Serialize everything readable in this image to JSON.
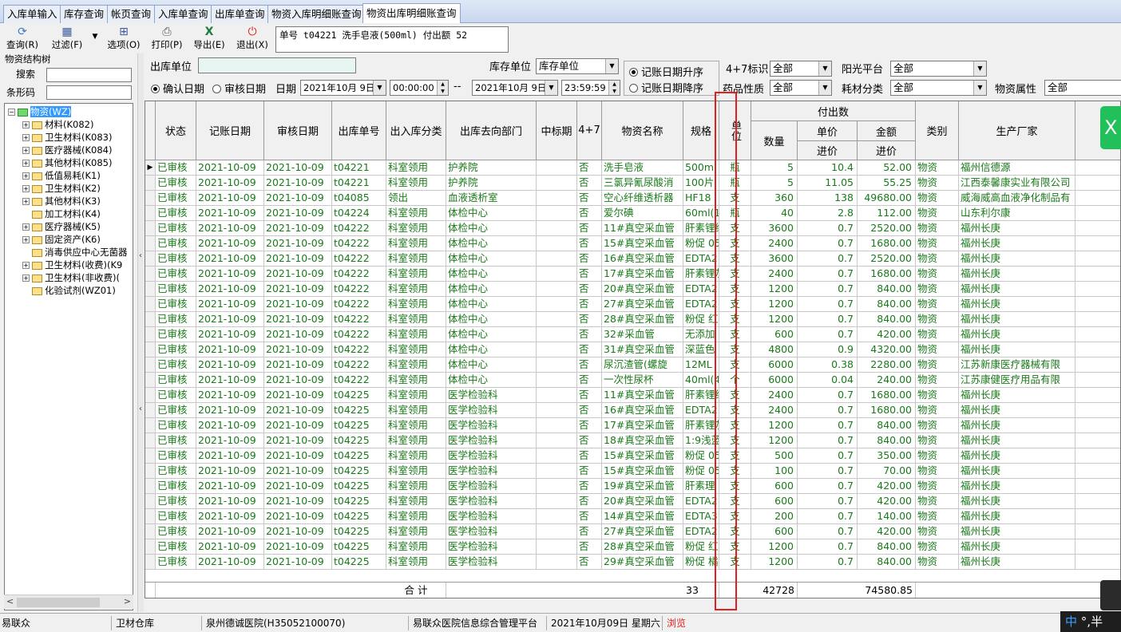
{
  "tabs": [
    "入库单输入",
    "库存查询",
    "帐页查询",
    "入库单查询",
    "出库单查询",
    "物资入库明细账查询",
    "物资出库明细账查询"
  ],
  "toolbar": {
    "query": "查询(R)",
    "filter": "过滤(F)",
    "options": "选项(O)",
    "print": "打印(P)",
    "export": "导出(E)",
    "exit": "退出(X)"
  },
  "info_text": "单号 t04221  洗手皂液(500ml) 付出额 52",
  "left": {
    "title": "物资结构树",
    "search_label": "搜索",
    "barcode_label": "条形码",
    "tree": [
      {
        "label": "物资(WZ)",
        "level": 0,
        "exp": "−",
        "selected": true
      },
      {
        "label": "材料(K082)",
        "level": 1,
        "exp": "+"
      },
      {
        "label": "卫生材料(K083)",
        "level": 1,
        "exp": "+"
      },
      {
        "label": "医疗器械(K084)",
        "level": 1,
        "exp": "+"
      },
      {
        "label": "其他材料(K085)",
        "level": 1,
        "exp": "+"
      },
      {
        "label": "低值易耗(K1)",
        "level": 1,
        "exp": "+"
      },
      {
        "label": "卫生材料(K2)",
        "level": 1,
        "exp": "+"
      },
      {
        "label": "其他材料(K3)",
        "level": 1,
        "exp": "+"
      },
      {
        "label": "加工材料(K4)",
        "level": 1,
        "exp": ""
      },
      {
        "label": "医疗器械(K5)",
        "level": 1,
        "exp": "+"
      },
      {
        "label": "固定资产(K6)",
        "level": 1,
        "exp": "+"
      },
      {
        "label": "消毒供应中心无菌器",
        "level": 1,
        "exp": ""
      },
      {
        "label": "卫生材料(收费)(K9",
        "level": 1,
        "exp": "+"
      },
      {
        "label": "卫生材料(非收费)(",
        "level": 1,
        "exp": "+"
      },
      {
        "label": "化验试剂(WZ01)",
        "level": 1,
        "exp": ""
      }
    ]
  },
  "filters": {
    "out_unit_label": "出库单位",
    "stock_unit_label": "库存单位",
    "stock_unit_value": "库存单位",
    "sort_asc": "记账日期升序",
    "sort_desc": "记账日期降序",
    "flag47_label": "4+7标识",
    "flag47_value": "全部",
    "sunplatform_label": "阳光平台",
    "sunplatform_value": "全部",
    "drug_label": "药品性质",
    "drug_value": "全部",
    "consum_label": "耗材分类",
    "consum_value": "全部",
    "attr_label": "物资属性",
    "attr_value": "全部",
    "confirm_date": "确认日期",
    "audit_date": "审核日期",
    "date_label": "日期",
    "date_from": "2021年10月 9日",
    "time_from": "00:00:00",
    "dash": "--",
    "date_to": "2021年10月 9日",
    "time_to": "23:59:59"
  },
  "grid": {
    "headers": {
      "status": "状态",
      "book_date": "记账日期",
      "audit_date": "审核日期",
      "out_no": "出库单号",
      "in_out_type": "出入库分类",
      "dept": "出库去向部门",
      "bid": "中标期",
      "plus47": "4+7",
      "name": "物资名称",
      "spec": "规格",
      "unit": "单位",
      "pay": "付出数",
      "qty": "数量",
      "unit_price": "单价",
      "purchase_price1": "进价",
      "amount": "金额",
      "purchase_price2": "进价",
      "category": "类别",
      "maker": "生产厂家"
    },
    "rows": [
      [
        "已审核",
        "2021-10-09",
        "2021-10-09",
        "t04221",
        "科室领用",
        "护养院",
        "",
        "否",
        "洗手皂液",
        "500ml",
        "瓶",
        "5",
        "10.4",
        "52.00",
        "物资",
        "福州信德源"
      ],
      [
        "已审核",
        "2021-10-09",
        "2021-10-09",
        "t04221",
        "科室领用",
        "护养院",
        "",
        "否",
        "三氯异氰尿酸消",
        "100片",
        "瓶",
        "5",
        "11.05",
        "55.25",
        "物资",
        "江西泰馨康实业有限公司"
      ],
      [
        "已审核",
        "2021-10-09",
        "2021-10-09",
        "t04085",
        "领出",
        "血液透析室",
        "",
        "否",
        "空心纤维透析器",
        "HF18",
        "支",
        "360",
        "138",
        "49680.00",
        "物资",
        "威海威高血液净化制品有"
      ],
      [
        "已审核",
        "2021-10-09",
        "2021-10-09",
        "t04224",
        "科室领用",
        "体检中心",
        "",
        "否",
        "爱尔碘",
        "60ml(10ml",
        "瓶",
        "40",
        "2.8",
        "112.00",
        "物资",
        "山东利尔康"
      ],
      [
        "已审核",
        "2021-10-09",
        "2021-10-09",
        "t04222",
        "科室领用",
        "体检中心",
        "",
        "否",
        "11#真空采血管",
        "肝素锂绿",
        "支",
        "3600",
        "0.7",
        "2520.00",
        "物资",
        "福州长庚"
      ],
      [
        "已审核",
        "2021-10-09",
        "2021-10-09",
        "t04222",
        "科室领用",
        "体检中心",
        "",
        "否",
        "15#真空采血管",
        "粉促 05ml",
        "支",
        "2400",
        "0.7",
        "1680.00",
        "物资",
        "福州长庚"
      ],
      [
        "已审核",
        "2021-10-09",
        "2021-10-09",
        "t04222",
        "科室领用",
        "体检中心",
        "",
        "否",
        "16#真空采血管",
        "EDTA2K (",
        "支",
        "3600",
        "0.7",
        "2520.00",
        "物资",
        "福州长庚"
      ],
      [
        "已审核",
        "2021-10-09",
        "2021-10-09",
        "t04222",
        "科室领用",
        "体检中心",
        "",
        "否",
        "17#真空采血管",
        "肝素锂灰",
        "支",
        "2400",
        "0.7",
        "1680.00",
        "物资",
        "福州长庚"
      ],
      [
        "已审核",
        "2021-10-09",
        "2021-10-09",
        "t04222",
        "科室领用",
        "体检中心",
        "",
        "否",
        "20#真空采血管",
        "EDTA2K 紫",
        "支",
        "1200",
        "0.7",
        "840.00",
        "物资",
        "福州长庚"
      ],
      [
        "已审核",
        "2021-10-09",
        "2021-10-09",
        "t04222",
        "科室领用",
        "体检中心",
        "",
        "否",
        "27#真空采血管",
        "EDTA2K (",
        "支",
        "1200",
        "0.7",
        "840.00",
        "物资",
        "福州长庚"
      ],
      [
        "已审核",
        "2021-10-09",
        "2021-10-09",
        "t04222",
        "科室领用",
        "体检中心",
        "",
        "否",
        "28#真空采血管",
        "粉促  红",
        "支",
        "1200",
        "0.7",
        "840.00",
        "物资",
        "福州长庚"
      ],
      [
        "已审核",
        "2021-10-09",
        "2021-10-09",
        "t04222",
        "科室领用",
        "体检中心",
        "",
        "否",
        "32#采血管",
        "无添加",
        "支",
        "600",
        "0.7",
        "420.00",
        "物资",
        "福州长庚"
      ],
      [
        "已审核",
        "2021-10-09",
        "2021-10-09",
        "t04222",
        "科室领用",
        "体检中心",
        "",
        "否",
        "31#真空采血管",
        "深蓝色",
        "支",
        "4800",
        "0.9",
        "4320.00",
        "物资",
        "福州长庚"
      ],
      [
        "已审核",
        "2021-10-09",
        "2021-10-09",
        "t04222",
        "科室领用",
        "体检中心",
        "",
        "否",
        "尿沉渣管(螺旋",
        "12ML",
        "支",
        "6000",
        "0.38",
        "2280.00",
        "物资",
        "江苏新康医疗器械有限"
      ],
      [
        "已审核",
        "2021-10-09",
        "2021-10-09",
        "t04222",
        "科室领用",
        "体检中心",
        "",
        "否",
        "一次性尿杯",
        "40ml(40C",
        "个",
        "6000",
        "0.04",
        "240.00",
        "物资",
        "江苏康健医疗用品有限"
      ],
      [
        "已审核",
        "2021-10-09",
        "2021-10-09",
        "t04225",
        "科室领用",
        "医学检验科",
        "",
        "否",
        "11#真空采血管",
        "肝素锂绿",
        "支",
        "2400",
        "0.7",
        "1680.00",
        "物资",
        "福州长庚"
      ],
      [
        "已审核",
        "2021-10-09",
        "2021-10-09",
        "t04225",
        "科室领用",
        "医学检验科",
        "",
        "否",
        "16#真空采血管",
        "EDTA2K (",
        "支",
        "2400",
        "0.7",
        "1680.00",
        "物资",
        "福州长庚"
      ],
      [
        "已审核",
        "2021-10-09",
        "2021-10-09",
        "t04225",
        "科室领用",
        "医学检验科",
        "",
        "否",
        "17#真空采血管",
        "肝素锂灰",
        "支",
        "1200",
        "0.7",
        "840.00",
        "物资",
        "福州长庚"
      ],
      [
        "已审核",
        "2021-10-09",
        "2021-10-09",
        "t04225",
        "科室领用",
        "医学检验科",
        "",
        "否",
        "18#真空采血管",
        "1:9浅蓝",
        "支",
        "1200",
        "0.7",
        "840.00",
        "物资",
        "福州长庚"
      ],
      [
        "已审核",
        "2021-10-09",
        "2021-10-09",
        "t04225",
        "科室领用",
        "医学检验科",
        "",
        "否",
        "15#真空采血管",
        "粉促 05ml",
        "支",
        "500",
        "0.7",
        "350.00",
        "物资",
        "福州长庚"
      ],
      [
        "已审核",
        "2021-10-09",
        "2021-10-09",
        "t04225",
        "科室领用",
        "医学检验科",
        "",
        "否",
        "15#真空采血管",
        "粉促 05ml",
        "支",
        "100",
        "0.7",
        "70.00",
        "物资",
        "福州长庚"
      ],
      [
        "已审核",
        "2021-10-09",
        "2021-10-09",
        "t04225",
        "科室领用",
        "医学检验科",
        "",
        "否",
        "19#真空采血管",
        "肝素理 )",
        "支",
        "600",
        "0.7",
        "420.00",
        "物资",
        "福州长庚"
      ],
      [
        "已审核",
        "2021-10-09",
        "2021-10-09",
        "t04225",
        "科室领用",
        "医学检验科",
        "",
        "否",
        "20#真空采血管",
        "EDTA2K 紫",
        "支",
        "600",
        "0.7",
        "420.00",
        "物资",
        "福州长庚"
      ],
      [
        "已审核",
        "2021-10-09",
        "2021-10-09",
        "t04225",
        "科室领用",
        "医学检验科",
        "",
        "否",
        "14#真空采血管",
        "EDTA3K (",
        "支",
        "200",
        "0.7",
        "140.00",
        "物资",
        "福州长庚"
      ],
      [
        "已审核",
        "2021-10-09",
        "2021-10-09",
        "t04225",
        "科室领用",
        "医学检验科",
        "",
        "否",
        "27#真空采血管",
        "EDTA2K (",
        "支",
        "600",
        "0.7",
        "420.00",
        "物资",
        "福州长庚"
      ],
      [
        "已审核",
        "2021-10-09",
        "2021-10-09",
        "t04225",
        "科室领用",
        "医学检验科",
        "",
        "否",
        "28#真空采血管",
        "粉促  红",
        "支",
        "1200",
        "0.7",
        "840.00",
        "物资",
        "福州长庚"
      ],
      [
        "已审核",
        "2021-10-09",
        "2021-10-09",
        "t04225",
        "科室领用",
        "医学检验科",
        "",
        "否",
        "29#真空采血管",
        "粉促  橘",
        "支",
        "1200",
        "0.7",
        "840.00",
        "物资",
        "福州长庚"
      ]
    ],
    "totals": {
      "label": "合  计",
      "count": "33",
      "qty": "42728",
      "amount": "74580.85"
    }
  },
  "statusbar": {
    "s1": "易联众",
    "s2": "卫材仓库",
    "s3": "泉州德诚医院(H35052100070)",
    "s4": "易联众医院信息综合管理平台",
    "s5": "2021年10月09日 星期六",
    "s6": "浏览"
  },
  "ime": {
    "lang": "中",
    "rest": "°,半"
  },
  "colors": {
    "data_text": "#1a7a1a",
    "highlight_box": "#e02020",
    "status_warn": "#e02020"
  }
}
